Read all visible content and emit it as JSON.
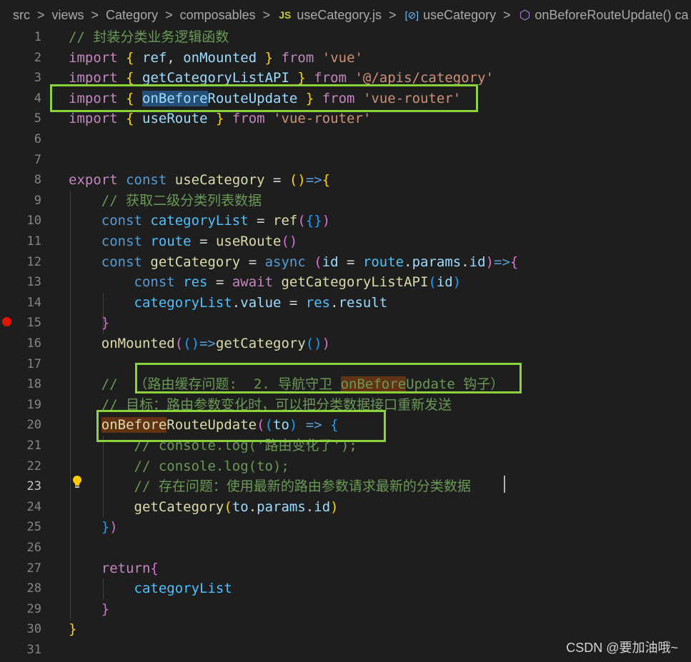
{
  "breadcrumb": {
    "items": [
      "src",
      "views",
      "Category",
      "composables",
      "useCategory.js",
      "useCategory",
      "onBeforeRouteUpdate() ca"
    ],
    "separator": ">"
  },
  "editor": {
    "active_line": 23,
    "breakpoint_line": 15,
    "lines": [
      {
        "n": "1",
        "tokens": [
          {
            "t": "// 封装分类业务逻辑函数",
            "c": "c"
          }
        ]
      },
      {
        "n": "2",
        "tokens": [
          {
            "t": "import",
            "c": "k"
          },
          {
            "t": " "
          },
          {
            "t": "{",
            "c": "b1"
          },
          {
            "t": " "
          },
          {
            "t": "ref",
            "c": "v"
          },
          {
            "t": ", "
          },
          {
            "t": "onMounted",
            "c": "v"
          },
          {
            "t": " "
          },
          {
            "t": "}",
            "c": "b1"
          },
          {
            "t": " "
          },
          {
            "t": "from",
            "c": "k"
          },
          {
            "t": " "
          },
          {
            "t": "'vue'",
            "c": "s"
          }
        ]
      },
      {
        "n": "3",
        "tokens": [
          {
            "t": "import",
            "c": "k"
          },
          {
            "t": " "
          },
          {
            "t": "{",
            "c": "b1"
          },
          {
            "t": " "
          },
          {
            "t": "getCategoryListAPI",
            "c": "v"
          },
          {
            "t": " "
          },
          {
            "t": "}",
            "c": "b1"
          },
          {
            "t": " "
          },
          {
            "t": "from",
            "c": "k"
          },
          {
            "t": " "
          },
          {
            "t": "'@/apis/category'",
            "c": "s"
          }
        ]
      },
      {
        "n": "4",
        "tokens": [
          {
            "t": "import",
            "c": "k"
          },
          {
            "t": " "
          },
          {
            "t": "{",
            "c": "b1"
          },
          {
            "t": " "
          },
          {
            "t": "onBefore",
            "c": "v hlsel"
          },
          {
            "t": "RouteUpdate",
            "c": "v"
          },
          {
            "t": " "
          },
          {
            "t": "}",
            "c": "b1"
          },
          {
            "t": " "
          },
          {
            "t": "from",
            "c": "k"
          },
          {
            "t": " "
          },
          {
            "t": "'vue-router'",
            "c": "s"
          }
        ]
      },
      {
        "n": "5",
        "tokens": [
          {
            "t": "import",
            "c": "k"
          },
          {
            "t": " "
          },
          {
            "t": "{",
            "c": "b1"
          },
          {
            "t": " "
          },
          {
            "t": "useRoute",
            "c": "v"
          },
          {
            "t": " "
          },
          {
            "t": "}",
            "c": "b1"
          },
          {
            "t": " "
          },
          {
            "t": "from",
            "c": "k"
          },
          {
            "t": " "
          },
          {
            "t": "'vue-router'",
            "c": "s"
          }
        ]
      },
      {
        "n": "6",
        "tokens": []
      },
      {
        "n": "7",
        "tokens": []
      },
      {
        "n": "8",
        "tokens": [
          {
            "t": "export",
            "c": "k"
          },
          {
            "t": " "
          },
          {
            "t": "const",
            "c": "kw"
          },
          {
            "t": " "
          },
          {
            "t": "useCategory",
            "c": "f"
          },
          {
            "t": " = "
          },
          {
            "t": "()",
            "c": "b1"
          },
          {
            "t": "=>",
            "c": "kw"
          },
          {
            "t": "{",
            "c": "b1"
          }
        ]
      },
      {
        "n": "9",
        "tokens": [
          {
            "t": "    "
          },
          {
            "t": "// 获取二级分类列表数据",
            "c": "c"
          }
        ]
      },
      {
        "n": "10",
        "tokens": [
          {
            "t": "    "
          },
          {
            "t": "const",
            "c": "kw"
          },
          {
            "t": " "
          },
          {
            "t": "categoryList",
            "c": "cn"
          },
          {
            "t": " = "
          },
          {
            "t": "ref",
            "c": "f"
          },
          {
            "t": "(",
            "c": "b2"
          },
          {
            "t": "{}",
            "c": "b3"
          },
          {
            "t": ")",
            "c": "b2"
          }
        ]
      },
      {
        "n": "11",
        "tokens": [
          {
            "t": "    "
          },
          {
            "t": "const",
            "c": "kw"
          },
          {
            "t": " "
          },
          {
            "t": "route",
            "c": "cn"
          },
          {
            "t": " = "
          },
          {
            "t": "useRoute",
            "c": "f"
          },
          {
            "t": "()",
            "c": "b2"
          }
        ]
      },
      {
        "n": "12",
        "tokens": [
          {
            "t": "    "
          },
          {
            "t": "const",
            "c": "kw"
          },
          {
            "t": " "
          },
          {
            "t": "getCategory",
            "c": "f"
          },
          {
            "t": " = "
          },
          {
            "t": "async",
            "c": "kw"
          },
          {
            "t": " "
          },
          {
            "t": "(",
            "c": "b2"
          },
          {
            "t": "id",
            "c": "v"
          },
          {
            "t": " = "
          },
          {
            "t": "route",
            "c": "cn"
          },
          {
            "t": "."
          },
          {
            "t": "params",
            "c": "v"
          },
          {
            "t": "."
          },
          {
            "t": "id",
            "c": "v"
          },
          {
            "t": ")",
            "c": "b2"
          },
          {
            "t": "=>",
            "c": "kw"
          },
          {
            "t": "{",
            "c": "b2"
          }
        ]
      },
      {
        "n": "13",
        "tokens": [
          {
            "t": "        "
          },
          {
            "t": "const",
            "c": "kw"
          },
          {
            "t": " "
          },
          {
            "t": "res",
            "c": "cn"
          },
          {
            "t": " = "
          },
          {
            "t": "await",
            "c": "k"
          },
          {
            "t": " "
          },
          {
            "t": "getCategoryListAPI",
            "c": "f"
          },
          {
            "t": "(",
            "c": "b3"
          },
          {
            "t": "id",
            "c": "v"
          },
          {
            "t": ")",
            "c": "b3"
          }
        ]
      },
      {
        "n": "14",
        "tokens": [
          {
            "t": "        "
          },
          {
            "t": "categoryList",
            "c": "cn"
          },
          {
            "t": "."
          },
          {
            "t": "value",
            "c": "v"
          },
          {
            "t": " = "
          },
          {
            "t": "res",
            "c": "cn"
          },
          {
            "t": "."
          },
          {
            "t": "result",
            "c": "v"
          }
        ]
      },
      {
        "n": "15",
        "tokens": [
          {
            "t": "    "
          },
          {
            "t": "}",
            "c": "b2"
          }
        ]
      },
      {
        "n": "16",
        "tokens": [
          {
            "t": "    "
          },
          {
            "t": "onMounted",
            "c": "f"
          },
          {
            "t": "(",
            "c": "b2"
          },
          {
            "t": "()",
            "c": "b3"
          },
          {
            "t": "=>",
            "c": "kw"
          },
          {
            "t": "getCategory",
            "c": "f"
          },
          {
            "t": "()",
            "c": "b3"
          },
          {
            "t": ")",
            "c": "b2"
          }
        ]
      },
      {
        "n": "17",
        "tokens": []
      },
      {
        "n": "18",
        "tokens": [
          {
            "t": "    "
          },
          {
            "t": "//  （路由缓存问题:  2. 导航守卫 ",
            "c": "c"
          },
          {
            "t": "onBefore",
            "c": "c hlword"
          },
          {
            "t": "Update 钩子）",
            "c": "c"
          }
        ]
      },
      {
        "n": "19",
        "tokens": [
          {
            "t": "    "
          },
          {
            "t": "// 目标：路由参数变化时，可以把分类数据接口重新发送",
            "c": "c"
          }
        ]
      },
      {
        "n": "20",
        "tokens": [
          {
            "t": "    "
          },
          {
            "t": "onBefore",
            "c": "f hlword"
          },
          {
            "t": "RouteUpdate",
            "c": "f"
          },
          {
            "t": "(",
            "c": "b2"
          },
          {
            "t": "(",
            "c": "b3"
          },
          {
            "t": "to",
            "c": "v"
          },
          {
            "t": ")",
            "c": "b3"
          },
          {
            "t": " "
          },
          {
            "t": "=>",
            "c": "kw"
          },
          {
            "t": " "
          },
          {
            "t": "{",
            "c": "b3"
          }
        ]
      },
      {
        "n": "21",
        "tokens": [
          {
            "t": "        "
          },
          {
            "t": "// console.log('路由变化了');",
            "c": "c"
          }
        ]
      },
      {
        "n": "22",
        "tokens": [
          {
            "t": "        "
          },
          {
            "t": "// console.log(to);",
            "c": "c"
          }
        ]
      },
      {
        "n": "23",
        "tokens": [
          {
            "t": "        "
          },
          {
            "t": "// 存在问题：使用最新的路由参数请求最新的分类数据",
            "c": "c"
          }
        ]
      },
      {
        "n": "24",
        "tokens": [
          {
            "t": "        "
          },
          {
            "t": "getCategory",
            "c": "f"
          },
          {
            "t": "(",
            "c": "b1"
          },
          {
            "t": "to",
            "c": "v"
          },
          {
            "t": "."
          },
          {
            "t": "params",
            "c": "v"
          },
          {
            "t": "."
          },
          {
            "t": "id",
            "c": "v"
          },
          {
            "t": ")",
            "c": "b1"
          }
        ]
      },
      {
        "n": "25",
        "tokens": [
          {
            "t": "    "
          },
          {
            "t": "}",
            "c": "b3"
          },
          {
            "t": ")",
            "c": "b2"
          }
        ]
      },
      {
        "n": "26",
        "tokens": []
      },
      {
        "n": "27",
        "tokens": [
          {
            "t": "    "
          },
          {
            "t": "return",
            "c": "k"
          },
          {
            "t": "{",
            "c": "b2"
          }
        ]
      },
      {
        "n": "28",
        "tokens": [
          {
            "t": "        "
          },
          {
            "t": "categoryList",
            "c": "cn"
          }
        ]
      },
      {
        "n": "29",
        "tokens": [
          {
            "t": "    "
          },
          {
            "t": "}",
            "c": "b2"
          }
        ]
      },
      {
        "n": "30",
        "tokens": [
          {
            "t": "}",
            "c": "b1"
          }
        ]
      },
      {
        "n": "31",
        "tokens": []
      }
    ]
  },
  "watermark": "CSDN @要加油哦~"
}
